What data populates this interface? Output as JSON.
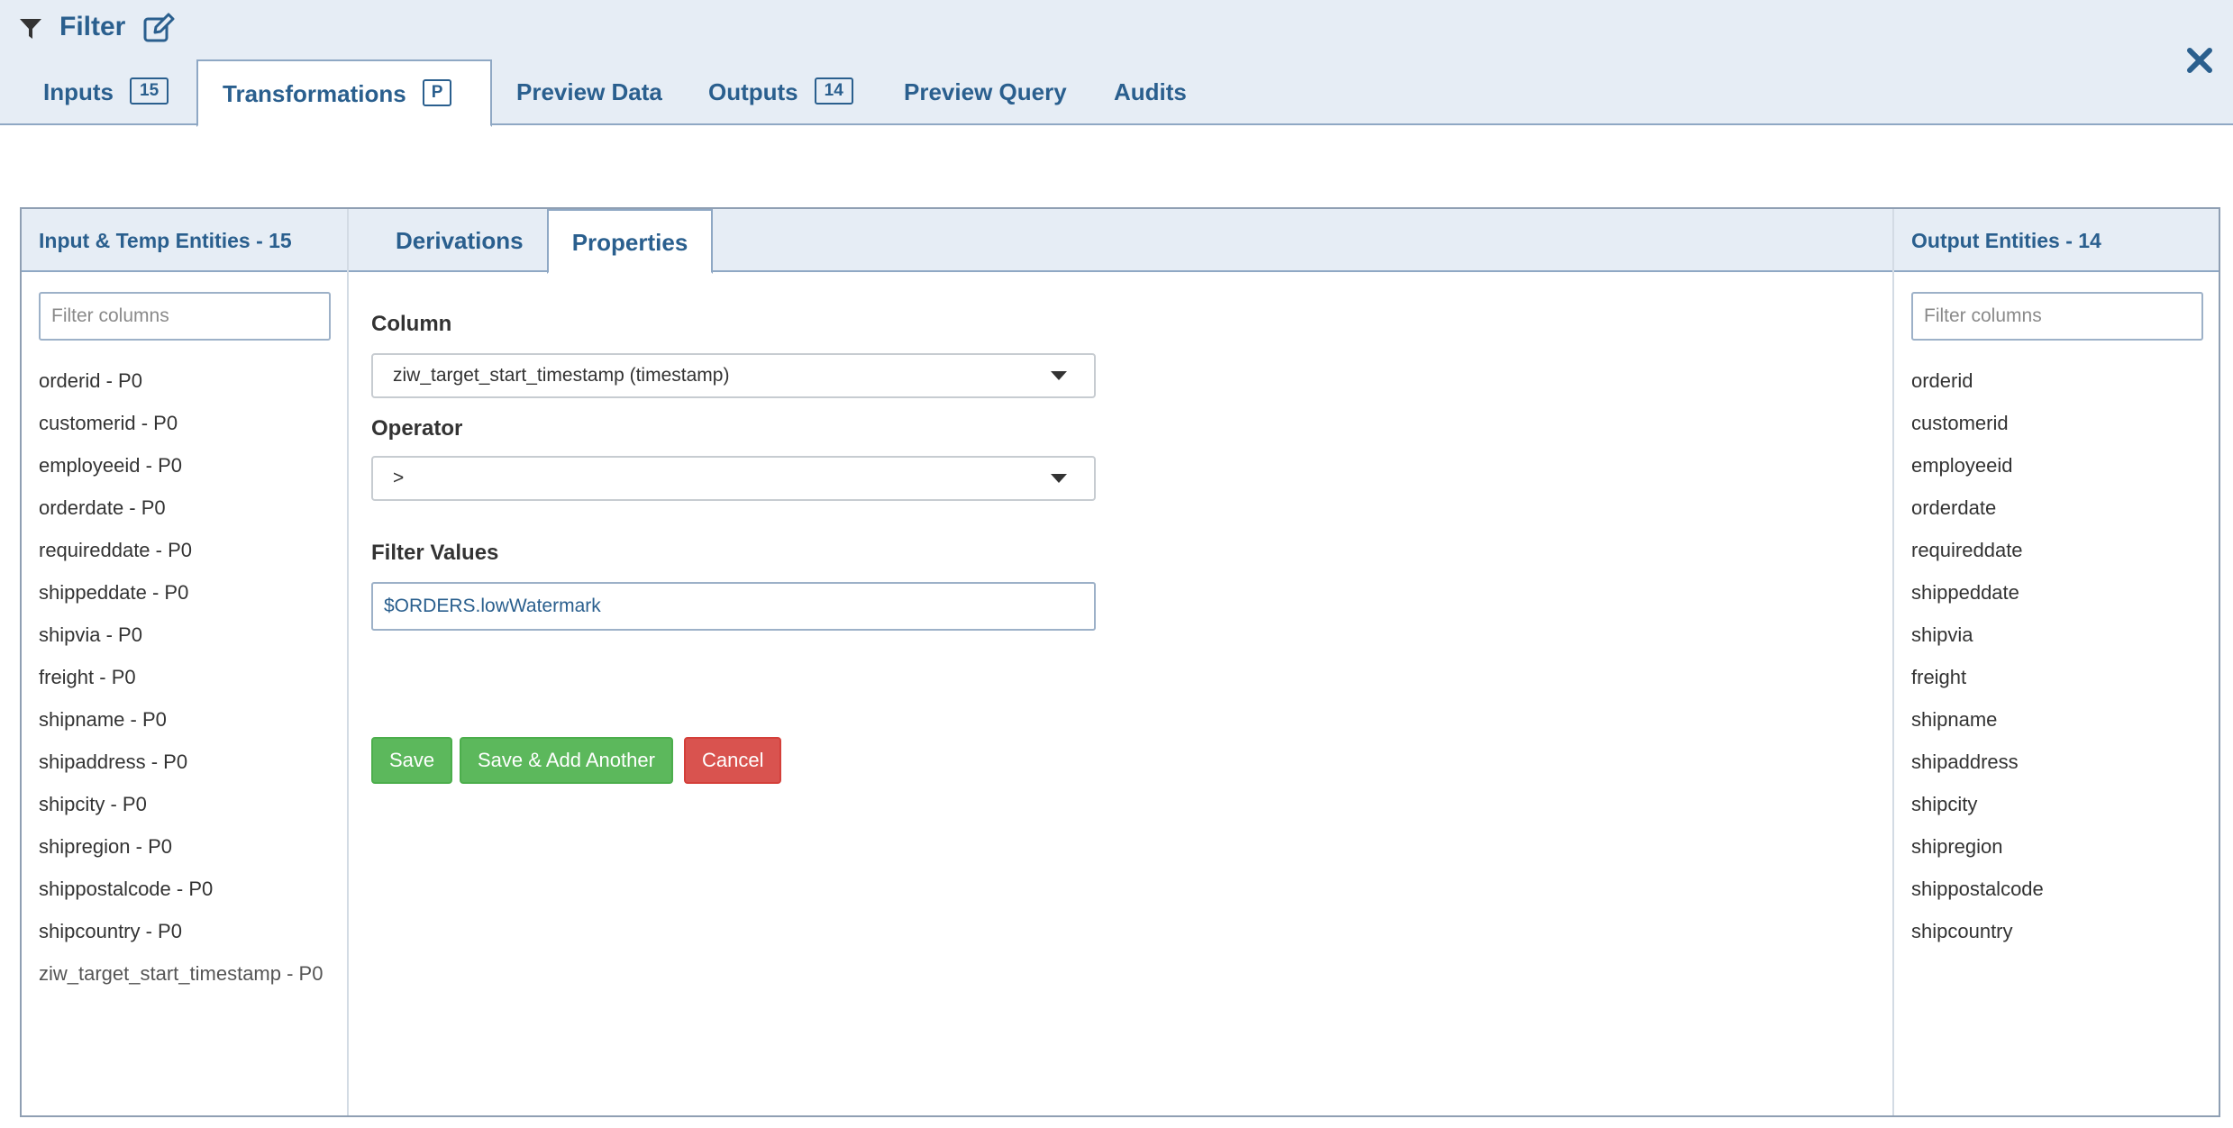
{
  "header": {
    "title": "Filter",
    "tabs": [
      {
        "label": "Inputs",
        "badge": "15"
      },
      {
        "label": "Transformations",
        "badge": "P"
      },
      {
        "label": "Preview Data"
      },
      {
        "label": "Outputs",
        "badge": "14"
      },
      {
        "label": "Preview Query"
      },
      {
        "label": "Audits"
      }
    ],
    "active_tab": "Transformations"
  },
  "left_panel": {
    "title": "Input & Temp Entities - 15",
    "filter_placeholder": "Filter columns",
    "items": [
      "orderid - P0",
      "customerid - P0",
      "employeeid - P0",
      "orderdate - P0",
      "requireddate - P0",
      "shippeddate - P0",
      "shipvia - P0",
      "freight - P0",
      "shipname - P0",
      "shipaddress - P0",
      "shipcity - P0",
      "shipregion - P0",
      "shippostalcode - P0",
      "shipcountry - P0",
      "ziw_target_start_timestamp - P0"
    ]
  },
  "center_panel": {
    "tabs": [
      {
        "label": "Derivations"
      },
      {
        "label": "Properties"
      }
    ],
    "active_tab": "Properties",
    "column_label": "Column",
    "column_value": "ziw_target_start_timestamp (timestamp)",
    "operator_label": "Operator",
    "operator_value": ">",
    "filter_values_label": "Filter Values",
    "filter_values_value": "$ORDERS.lowWatermark",
    "buttons": {
      "save": "Save",
      "save_add": "Save & Add Another",
      "cancel": "Cancel"
    }
  },
  "right_panel": {
    "title": "Output Entities  - 14",
    "filter_placeholder": "Filter columns",
    "items": [
      "orderid",
      "customerid",
      "employeeid",
      "orderdate",
      "requireddate",
      "shippeddate",
      "shipvia",
      "freight",
      "shipname",
      "shipaddress",
      "shipcity",
      "shipregion",
      "shippostalcode",
      "shipcountry"
    ]
  },
  "icons": {
    "filter": "filter-funnel-icon",
    "edit": "edit-pencil-icon",
    "close": "close-x-icon"
  },
  "colors": {
    "accent": "#2a5f8e",
    "header_bg": "#e6edf5",
    "save_green": "#5cb85c",
    "cancel_red": "#d9534f"
  }
}
